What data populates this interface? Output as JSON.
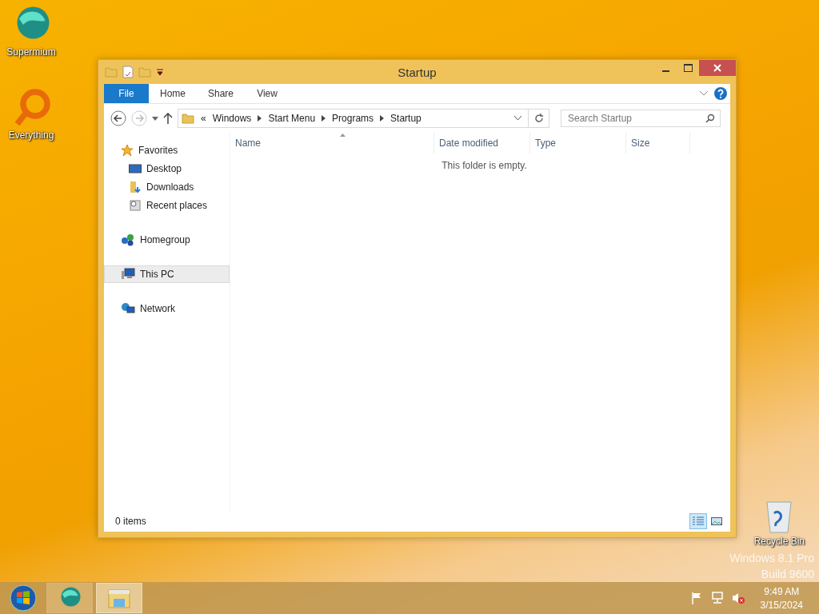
{
  "desktop_icons": [
    {
      "label": "Supermium",
      "kind": "browser"
    },
    {
      "label": "Everything",
      "kind": "search"
    }
  ],
  "recycle_bin": {
    "label": "Recycle Bin"
  },
  "watermark": [
    "Windows 8.1 Pro",
    "Build 9600"
  ],
  "window": {
    "title": "Startup",
    "ribbon_tabs": [
      {
        "label": "File",
        "kind": "file"
      },
      {
        "label": "Home",
        "kind": "tab"
      },
      {
        "label": "Share",
        "kind": "tab"
      },
      {
        "label": "View",
        "kind": "tab"
      }
    ],
    "address": {
      "overflow": "«",
      "crumbs": [
        "Windows",
        "Start Menu",
        "Programs",
        "Startup"
      ]
    },
    "search": {
      "placeholder": "Search Startup"
    },
    "nav_groups": [
      {
        "label": "Favorites",
        "kind": "favorites",
        "selected": false,
        "children": [
          {
            "label": "Desktop",
            "kind": "desktop",
            "selected": false
          },
          {
            "label": "Downloads",
            "kind": "downloads",
            "selected": false
          },
          {
            "label": "Recent places",
            "kind": "recent",
            "selected": false
          }
        ]
      },
      {
        "label": "Homegroup",
        "kind": "homegroup",
        "selected": false
      },
      {
        "label": "This PC",
        "kind": "pc",
        "selected": true
      },
      {
        "label": "Network",
        "kind": "network",
        "selected": false
      }
    ],
    "columns": [
      "Name",
      "Date modified",
      "Type",
      "Size"
    ],
    "empty_message": "This folder is empty.",
    "status": "0 items",
    "view_buttons": [
      {
        "kind": "details",
        "selected": true
      },
      {
        "kind": "tiles",
        "selected": false
      }
    ]
  },
  "taskbar": {
    "items": [
      {
        "kind": "browser",
        "active": false
      },
      {
        "kind": "explorer",
        "active": true
      }
    ],
    "clock": {
      "time": "9:49 AM",
      "date": "3/15/2024"
    }
  }
}
